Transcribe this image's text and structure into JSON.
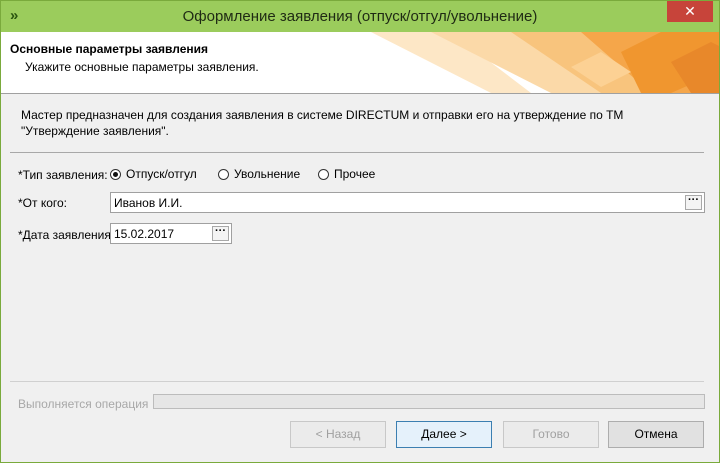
{
  "window": {
    "title": "Оформление заявления (отпуск/отгул/увольнение)",
    "close_glyph": "✕",
    "app_icon": "»"
  },
  "header": {
    "title": "Основные параметры заявления",
    "subtitle": "Укажите основные параметры заявления."
  },
  "description": "Мастер предназначен для создания заявления в системе DIRECTUM и отправки его на утверждение по ТМ \"Утверждение заявления\".",
  "form": {
    "type_label": "*Тип заявления:",
    "type_options": [
      {
        "label": "Отпуск/отгул",
        "selected": true
      },
      {
        "label": "Увольнение",
        "selected": false
      },
      {
        "label": "Прочее",
        "selected": false
      }
    ],
    "from_label": "*От кого:",
    "from_value": "Иванов И.И.",
    "date_label": "*Дата заявления:",
    "date_value": "15.02.2017",
    "lookup_button": "···"
  },
  "status": {
    "label": "Выполняется операция",
    "progress": 0
  },
  "buttons": {
    "back": "< Назад",
    "next": "Далее >",
    "finish": "Готово",
    "cancel": "Отмена"
  },
  "colors": {
    "titlebar": "#9bcc5c",
    "close": "#c7443a",
    "banner_orange": "#f5a64a",
    "banner_light": "#fbd9a8"
  }
}
